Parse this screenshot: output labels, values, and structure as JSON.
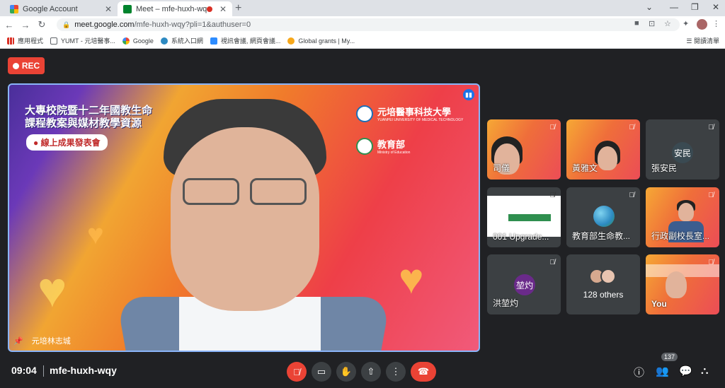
{
  "browser": {
    "tabs": [
      {
        "title": "Google Account",
        "active": false
      },
      {
        "title": "Meet – mfe-huxh-wqy",
        "active": true
      }
    ],
    "url": {
      "host": "meet.google.com",
      "path": "/mfe-huxh-wqy?pli=1&authuser=0"
    },
    "bookmarks": [
      "應用程式",
      "YUMT - 元培醫事...",
      "Google",
      "系統入口網",
      "視訊會議, 網頁會議...",
      "Global grants | My..."
    ],
    "reading_list": "閱讀清單"
  },
  "meet": {
    "rec_label": "REC",
    "main_speaker": {
      "name": "元培林志城",
      "banner_line1": "大專校院暨十二年國教生命",
      "banner_line2": "課程教案與媒材教學資源",
      "banner_pill": "線上成果發表會",
      "logo1": "元培醫事科技大學",
      "logo1_sub": "YUANPEI UNIVERSITY OF MEDICAL TECHNOLOGY",
      "logo2": "教育部",
      "logo2_sub": "Ministry of Education"
    },
    "tiles": [
      {
        "name": "司儀"
      },
      {
        "name": "黃雅文"
      },
      {
        "name": "張安民",
        "initials": "安民"
      },
      {
        "name": "001 Upgrade..."
      },
      {
        "name": "教育部生命教..."
      },
      {
        "name": "行政副校長室..."
      },
      {
        "name": "洪堃灼",
        "initials": "堃灼"
      },
      {
        "name": "128 others"
      },
      {
        "name": "You"
      }
    ],
    "time": "09:04",
    "meeting_code": "mfe-huxh-wqy",
    "people_count": "137"
  },
  "colors": {
    "accent": "#8ab4f8",
    "rec": "#ea4335",
    "bg": "#202124"
  }
}
